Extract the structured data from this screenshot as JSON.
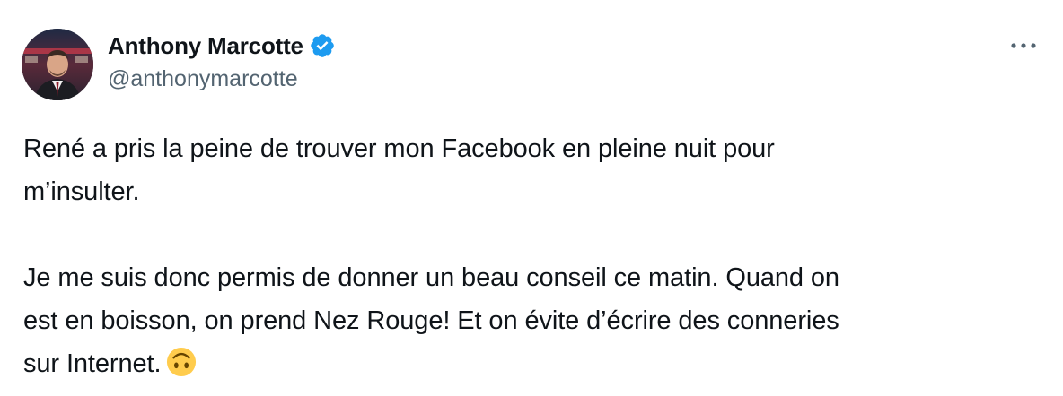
{
  "author": {
    "display_name": "Anthony Marcotte",
    "handle": "@anthonymarcotte",
    "verified": true,
    "verified_color": "#1d9bf0"
  },
  "menu_icon": "more-horizontal-icon",
  "tweet": {
    "paragraph_1_line_1": "René a pris la peine de trouver mon Facebook en pleine nuit pour",
    "paragraph_1_line_2": "m’insulter.",
    "paragraph_2_line_1": "Je me suis donc permis de donner un beau conseil ce matin. Quand on",
    "paragraph_2_line_2": "est en boisson, on prend Nez Rouge! Et on évite d’écrire des conneries",
    "paragraph_2_line_3": "sur Internet.",
    "emoji": "upside-down-face"
  },
  "colors": {
    "text": "#0f1419",
    "secondary": "#536471"
  }
}
